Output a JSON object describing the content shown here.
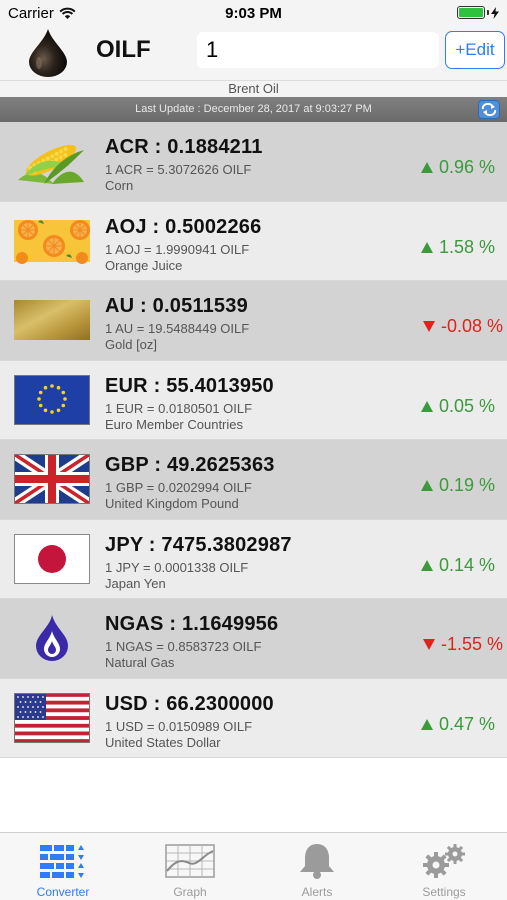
{
  "status_bar": {
    "carrier": "Carrier",
    "time": "9:03 PM"
  },
  "header": {
    "base_code": "OILF",
    "amount_value": "1",
    "edit_label": "+Edit",
    "base_name": "Brent Oil"
  },
  "update_bar": {
    "text": "Last Update : December 28, 2017 at 9:03:27 PM"
  },
  "rows": [
    {
      "icon": "corn-icon",
      "main": "ACR : 0.1884211",
      "conversion": "1 ACR = 5.3072626 OILF",
      "name": "Corn",
      "change": "0.96 %",
      "direction": "up"
    },
    {
      "icon": "orange-icon",
      "main": "AOJ : 0.5002266",
      "conversion": "1 AOJ = 1.9990941 OILF",
      "name": "Orange Juice",
      "change": "1.58 %",
      "direction": "up"
    },
    {
      "icon": "gold-bar-icon",
      "main": "AU : 0.0511539",
      "conversion": "1 AU = 19.5488449 OILF",
      "name": "Gold [oz]",
      "change": "-0.08 %",
      "direction": "down"
    },
    {
      "icon": "eu-flag-icon",
      "main": "EUR : 55.4013950",
      "conversion": "1 EUR = 0.0180501 OILF",
      "name": "Euro Member Countries",
      "change": "0.05 %",
      "direction": "up"
    },
    {
      "icon": "uk-flag-icon",
      "main": "GBP : 49.2625363",
      "conversion": "1 GBP = 0.0202994 OILF",
      "name": "United Kingdom Pound",
      "change": "0.19 %",
      "direction": "up"
    },
    {
      "icon": "japan-flag-icon",
      "main": "JPY : 7475.3802987",
      "conversion": "1 JPY = 0.0001338 OILF",
      "name": "Japan Yen",
      "change": "0.14 %",
      "direction": "up"
    },
    {
      "icon": "gas-flame-icon",
      "main": "NGAS : 1.1649956",
      "conversion": "1 NGAS = 0.8583723 OILF",
      "name": "Natural Gas",
      "change": "-1.55 %",
      "direction": "down"
    },
    {
      "icon": "us-flag-icon",
      "main": "USD : 66.2300000",
      "conversion": "1 USD = 0.0150989 OILF",
      "name": "United States Dollar",
      "change": "0.47 %",
      "direction": "up"
    }
  ],
  "tabs": [
    {
      "label": "Converter",
      "icon": "converter-icon",
      "active": true
    },
    {
      "label": "Graph",
      "icon": "graph-icon",
      "active": false
    },
    {
      "label": "Alerts",
      "icon": "bell-icon",
      "active": false
    },
    {
      "label": "Settings",
      "icon": "gear-icon",
      "active": false
    }
  ],
  "colors": {
    "accent": "#2f7cf6",
    "positive": "#3b9a3b",
    "negative": "#e0221b"
  }
}
